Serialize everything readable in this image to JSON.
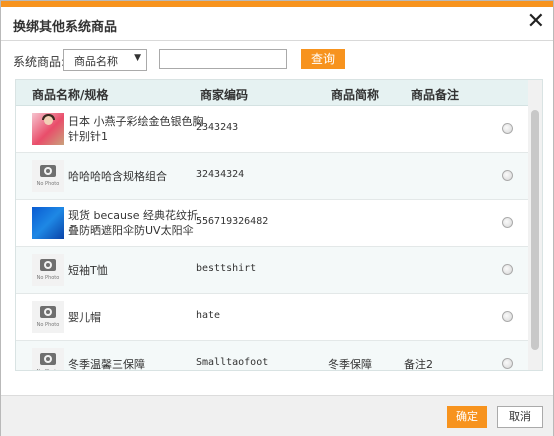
{
  "dialog": {
    "title": "换绑其他系统商品",
    "close_symbol": "✕"
  },
  "filter": {
    "label": "系统商品:",
    "select_value": "商品名称",
    "input_value": "",
    "search_label": "查询"
  },
  "table": {
    "headers": [
      "商品名称/规格",
      "商家编码",
      "商品简称",
      "商品备注"
    ],
    "rows": [
      {
        "image": "product-photo",
        "name": "日本 小燕子彩绘金色银色胸针别针1",
        "code": "2343243",
        "abbr": "",
        "note": ""
      },
      {
        "image": "no-photo",
        "name": "哈哈哈哈含规格组合",
        "code": "32434324",
        "abbr": "",
        "note": ""
      },
      {
        "image": "product-photo-blue",
        "name": "现货 because 经典花纹折叠防晒遮阳伞防UV太阳伞",
        "code": "556719326482",
        "abbr": "",
        "note": ""
      },
      {
        "image": "no-photo",
        "name": "短袖T恤",
        "code": "besttshirt",
        "abbr": "",
        "note": ""
      },
      {
        "image": "no-photo",
        "name": "婴儿帽",
        "code": "hate",
        "abbr": "",
        "note": ""
      },
      {
        "image": "no-photo",
        "name": "冬季温馨三保障",
        "code": "Smalltaofoot",
        "abbr": "冬季保障",
        "note": "备注2"
      }
    ],
    "no_photo_text": "No Photo"
  },
  "footer": {
    "ok_label": "确定",
    "cancel_label": "取消"
  },
  "colors": {
    "accent": "#f7931e",
    "header_bg": "#e6f2f2"
  }
}
